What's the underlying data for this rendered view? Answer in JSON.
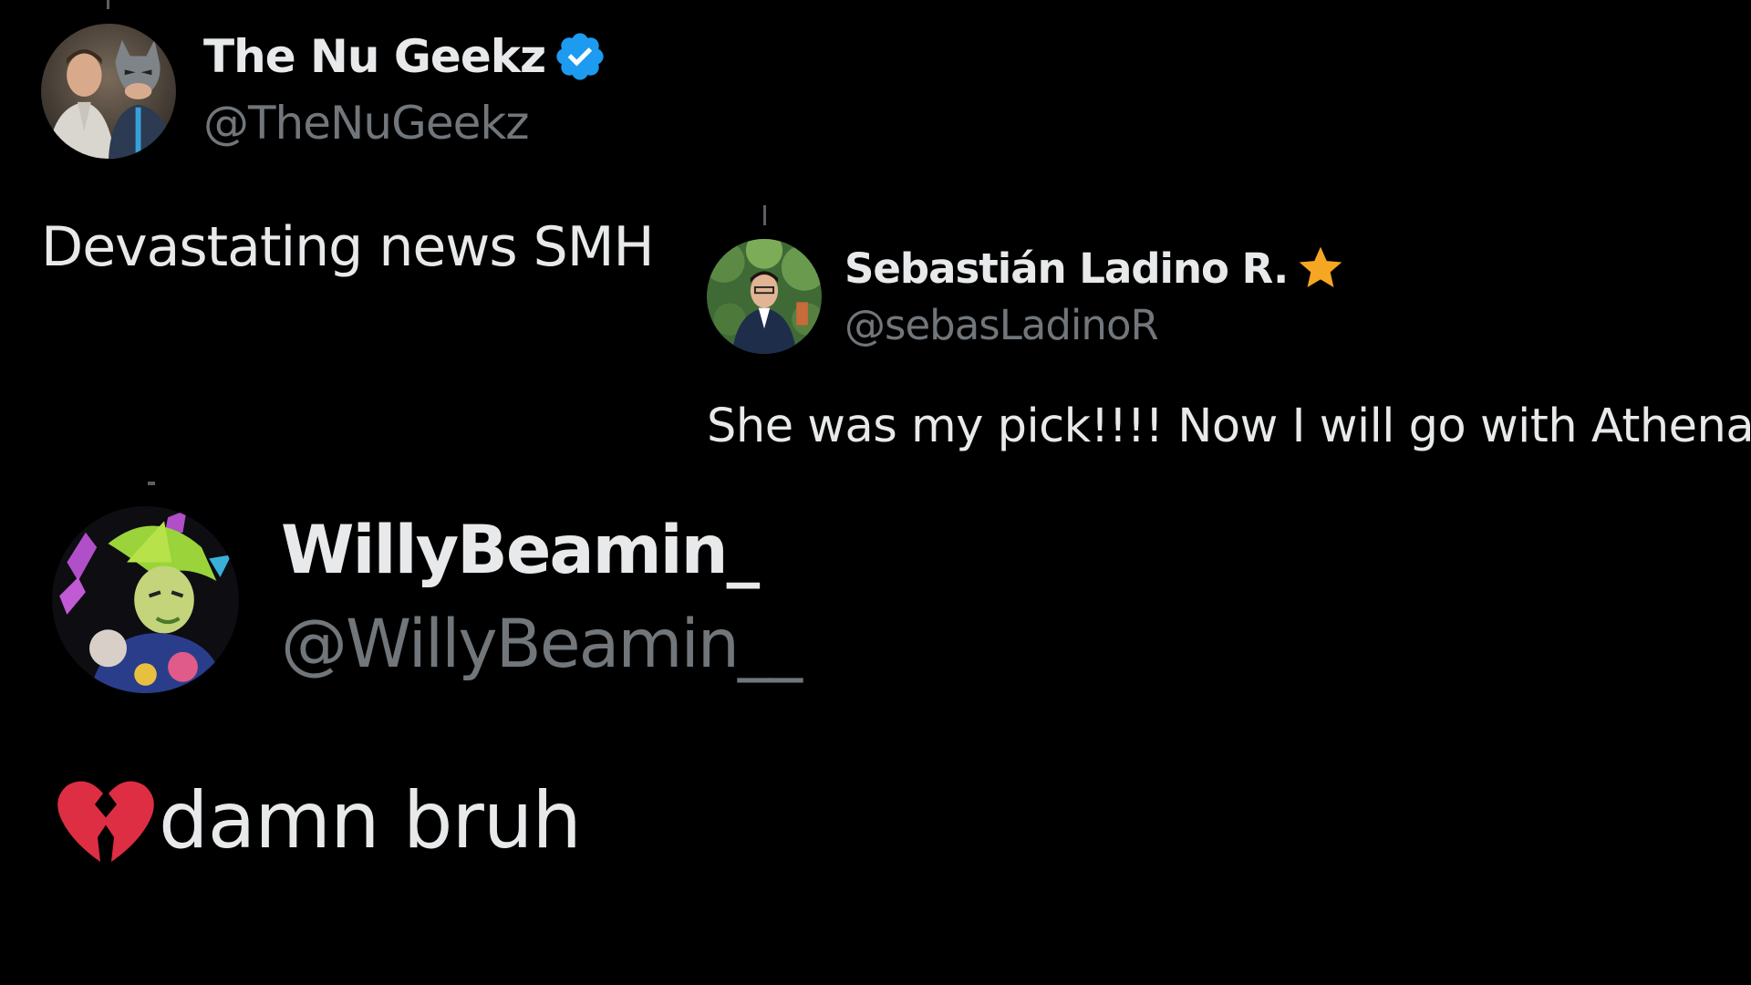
{
  "colors": {
    "background": "#000000",
    "text_primary": "#e7e9ea",
    "text_secondary": "#71767b",
    "verified_blue": "#1d9bf0",
    "star_gold": "#f5a623",
    "broken_heart": "#dd2e44"
  },
  "tweets": [
    {
      "display_name": "The Nu Geekz",
      "handle": "@TheNuGeekz",
      "badge": "verified-badge-icon",
      "text": "Devastating news SMH"
    },
    {
      "display_name": "Sebastián Ladino R.",
      "handle": "@sebasLadinoR",
      "badge": "star-icon",
      "text": "She was my pick!!!! Now I will go with Athena"
    },
    {
      "display_name": "WillyBeamin_",
      "handle": "@WillyBeamin__",
      "emoji": "broken-heart-icon",
      "text": "damn bruh"
    }
  ]
}
